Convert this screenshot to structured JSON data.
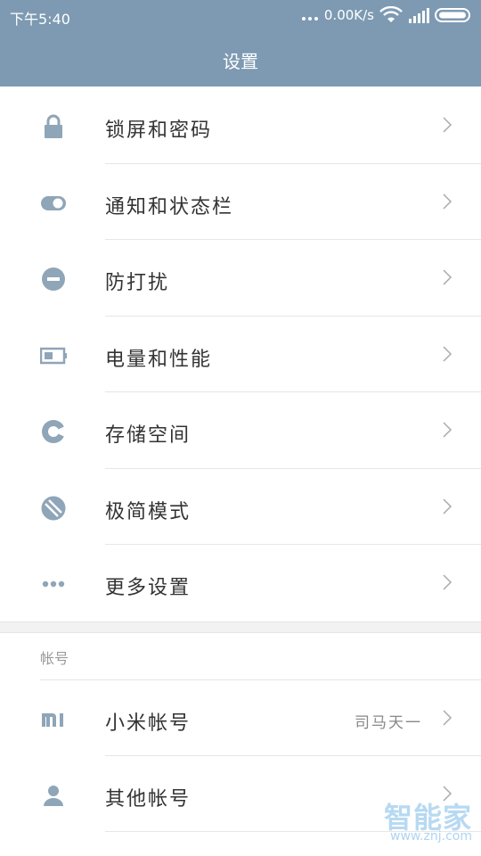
{
  "status_bar": {
    "time": "下午5:40",
    "speed": "0.00K/s",
    "icons": [
      "more-dots-icon",
      "wifi-icon",
      "signal-icon",
      "battery-icon"
    ]
  },
  "header": {
    "title": "设置"
  },
  "settings_items": [
    {
      "label": "锁屏和密码",
      "icon": "lock-icon"
    },
    {
      "label": "通知和状态栏",
      "icon": "toggle-icon"
    },
    {
      "label": "防打扰",
      "icon": "do-not-disturb-icon"
    },
    {
      "label": "电量和性能",
      "icon": "battery-icon"
    },
    {
      "label": "存储空间",
      "icon": "storage-pie-icon"
    },
    {
      "label": "极简模式",
      "icon": "lite-mode-icon"
    },
    {
      "label": "更多设置",
      "icon": "more-dots-icon"
    }
  ],
  "accounts_section": {
    "header": "帐号",
    "items": [
      {
        "label": "小米帐号",
        "value": "司马天一",
        "icon": "mi-logo-icon"
      },
      {
        "label": "其他帐号",
        "icon": "person-icon"
      }
    ]
  },
  "watermark": {
    "text": "智能家",
    "url": "www.znj.com"
  },
  "colors": {
    "header_bg": "#7d9ab2",
    "icon": "#8fa5b8",
    "text": "#333333"
  }
}
